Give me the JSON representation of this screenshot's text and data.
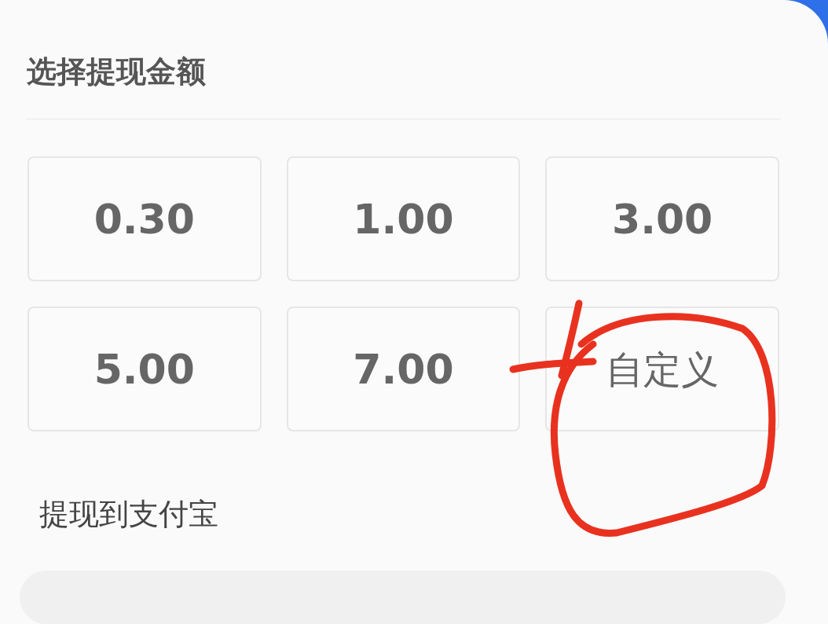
{
  "title": "选择提现金额",
  "amounts": [
    {
      "label": "0.30",
      "kind": "amount"
    },
    {
      "label": "1.00",
      "kind": "amount"
    },
    {
      "label": "3.00",
      "kind": "amount"
    },
    {
      "label": "5.00",
      "kind": "amount"
    },
    {
      "label": "7.00",
      "kind": "amount"
    },
    {
      "label": "自定义",
      "kind": "custom"
    }
  ],
  "withdraw_to": {
    "label": "提现到支付宝"
  }
}
